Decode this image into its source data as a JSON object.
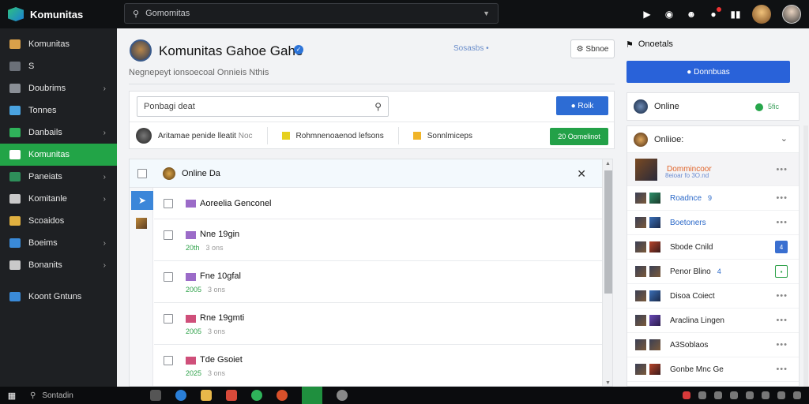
{
  "app": {
    "name": "Komunitas"
  },
  "topbar": {
    "search_text": "Gomomitas",
    "icons": [
      "play-icon",
      "chat-bubble-icon",
      "people-icon",
      "notification-icon",
      "bars-icon"
    ]
  },
  "sidebar": {
    "items": [
      {
        "label": "Komunitas",
        "icon": "community-icon",
        "color": "#d9a04a",
        "arrow": false,
        "active": false
      },
      {
        "label": "S",
        "icon": "star-icon",
        "color": "#6b7078",
        "arrow": false,
        "active": false
      },
      {
        "label": "Doubrims",
        "icon": "document-icon",
        "color": "#8a8f96",
        "arrow": true,
        "active": false
      },
      {
        "label": "Tonnes",
        "icon": "monitor-icon",
        "color": "#4aa3e0",
        "arrow": false,
        "active": false
      },
      {
        "label": "Danbails",
        "icon": "game-icon",
        "color": "#2fb35a",
        "arrow": true,
        "active": false
      },
      {
        "label": "Komunitas",
        "icon": "grid-icon",
        "color": "#ffffff",
        "arrow": false,
        "active": true
      },
      {
        "label": "Paneiats",
        "icon": "panel-icon",
        "color": "#2e8f5a",
        "arrow": true,
        "active": false
      },
      {
        "label": "Komitanle",
        "icon": "group-icon",
        "color": "#c9c9c9",
        "arrow": true,
        "active": false
      },
      {
        "label": "Scoaidos",
        "icon": "trophy-icon",
        "color": "#e0b040",
        "arrow": false,
        "active": false
      },
      {
        "label": "Boeims",
        "icon": "globe-icon",
        "color": "#3a8ad8",
        "arrow": true,
        "active": false
      },
      {
        "label": "Bonanits",
        "icon": "gear-icon",
        "color": "#c9c9c9",
        "arrow": true,
        "active": false
      }
    ],
    "footer": {
      "label": "Koont Gntuns",
      "icon": "settings-icon",
      "color": "#3a8ad8"
    }
  },
  "main": {
    "title": "Komunitas Gahoe Gahe",
    "header_link": "Sosasbs",
    "header_button": "Sbnoe",
    "subtitle": "Negnepeyt ionsoecoal Onnieis Nthis",
    "filter": {
      "search_placeholder": "Ponbagi deat",
      "search_button": "Roik",
      "items": [
        {
          "label": "Aritamae penide lleatit",
          "muted": "Noc"
        },
        {
          "label": "Rohmnenoaenod lefsons"
        },
        {
          "label": "Sonnlmiceps"
        }
      ],
      "green_button": "20 Oomelinot"
    },
    "list": {
      "header_title": "Online Da",
      "rows": [
        {
          "title": "Aoreelia Genconel",
          "sub": "",
          "sub_muted": "",
          "color": "purple"
        },
        {
          "title": "Nne 19gin",
          "sub": "20th",
          "sub_muted": "3 ons",
          "color": "purple"
        },
        {
          "title": "Fne 10gfal",
          "sub": "2005",
          "sub_muted": "3 ons",
          "color": "purple"
        },
        {
          "title": "Rne 19gmti",
          "sub": "2005",
          "sub_muted": "3 ons",
          "color": "pink"
        },
        {
          "title": "Tde Gsoiet",
          "sub": "2025",
          "sub_muted": "3 ons",
          "color": "pink"
        }
      ]
    }
  },
  "right": {
    "header": "Onoetals",
    "primary_button": "Donnbuas",
    "online_card": {
      "label": "Online",
      "status": "5fic"
    },
    "online_panel": {
      "title": "Onliioe:",
      "users": [
        {
          "name": "Dommincoor",
          "sub": "8eioar fo 3O.nd",
          "style": "orange",
          "action": "more",
          "avatar": "default"
        },
        {
          "name": "Roadnce",
          "mark": "9",
          "style": "blue",
          "action": "more",
          "avatar": "g2"
        },
        {
          "name": "Boetoners",
          "style": "blue",
          "action": "more",
          "avatar": "b2"
        },
        {
          "name": "Sbode Cnild",
          "style": "normal",
          "action": "badge",
          "badge": "4",
          "avatar": "r2"
        },
        {
          "name": "Penor Blino",
          "mark": "4",
          "style": "normal",
          "action": "outline",
          "avatar": "default"
        },
        {
          "name": "Disoa Coiect",
          "style": "normal",
          "action": "more",
          "avatar": "b2"
        },
        {
          "name": "Araclina Lingen",
          "style": "normal",
          "action": "more",
          "avatar": "p2"
        },
        {
          "name": "A3Soblaos",
          "style": "normal",
          "action": "more",
          "avatar": "default"
        },
        {
          "name": "Gonbe Mnc Ge",
          "style": "normal",
          "action": "more",
          "avatar": "r2"
        }
      ]
    }
  },
  "taskbar": {
    "search_text": "Sontadin"
  },
  "colors": {
    "accent_green": "#22a447",
    "accent_blue": "#2962d9",
    "topbar_bg": "#0f1113",
    "sidebar_bg": "#1e2023"
  }
}
